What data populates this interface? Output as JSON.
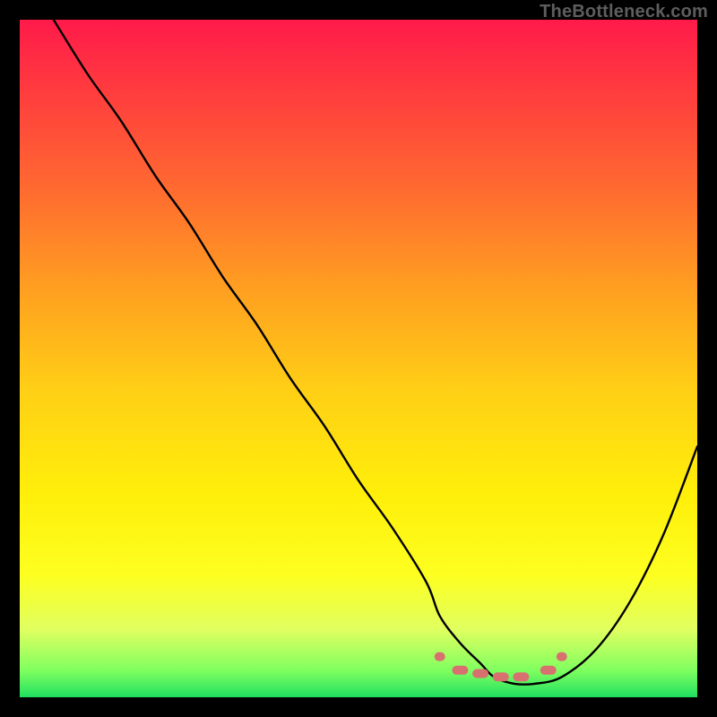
{
  "watermark": "TheBottleneck.com",
  "chart_data": {
    "type": "line",
    "title": "",
    "xlabel": "",
    "ylabel": "",
    "x_range": [
      0,
      100
    ],
    "y_range": [
      0,
      100
    ],
    "series": [
      {
        "name": "bottleneck-curve",
        "x": [
          5,
          10,
          15,
          20,
          25,
          30,
          35,
          40,
          45,
          50,
          55,
          60,
          62,
          65,
          68,
          70,
          73,
          76,
          80,
          85,
          90,
          95,
          100
        ],
        "y": [
          100,
          92,
          85,
          77,
          70,
          62,
          55,
          47,
          40,
          32,
          25,
          17,
          12,
          8,
          5,
          3,
          2,
          2,
          3,
          7,
          14,
          24,
          37
        ]
      }
    ],
    "markers": [
      {
        "name": "optimal-range-marker",
        "shape": "rounded-rect",
        "color": "#d97070",
        "points": [
          {
            "x": 62,
            "y": 6
          },
          {
            "x": 65,
            "y": 4
          },
          {
            "x": 68,
            "y": 3.5
          },
          {
            "x": 71,
            "y": 3
          },
          {
            "x": 74,
            "y": 3
          },
          {
            "x": 78,
            "y": 4
          },
          {
            "x": 80,
            "y": 6
          }
        ]
      }
    ],
    "background_gradient": {
      "stops": [
        {
          "pos": 0,
          "color": "#ff1a4a"
        },
        {
          "pos": 10,
          "color": "#ff3a3f"
        },
        {
          "pos": 25,
          "color": "#ff6a30"
        },
        {
          "pos": 40,
          "color": "#ffa020"
        },
        {
          "pos": 55,
          "color": "#ffd015"
        },
        {
          "pos": 70,
          "color": "#ffef0a"
        },
        {
          "pos": 82,
          "color": "#fdff20"
        },
        {
          "pos": 90,
          "color": "#e0ff60"
        },
        {
          "pos": 96,
          "color": "#80ff60"
        },
        {
          "pos": 100,
          "color": "#20e060"
        }
      ]
    }
  }
}
